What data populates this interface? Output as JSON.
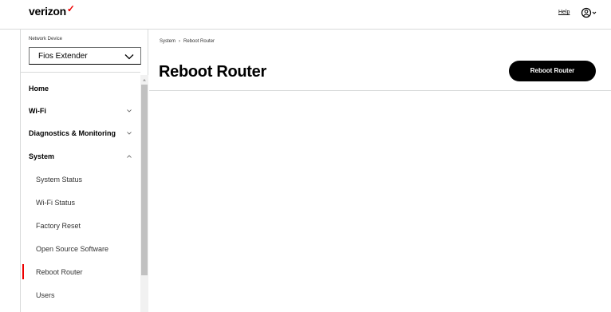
{
  "header": {
    "logo_text": "verizon",
    "logo_mark": "✓",
    "brand_color": "#ee0000",
    "help_label": "Help",
    "user_icon": "user-circle-icon"
  },
  "sidebar": {
    "device_label": "Network Device",
    "device_value": "Fios Extender",
    "items": [
      {
        "label": "Home",
        "kind": "top"
      },
      {
        "label": "Wi-Fi",
        "kind": "top",
        "chevron": "down"
      },
      {
        "label": "Diagnostics & Monitoring",
        "kind": "top",
        "chevron": "down"
      },
      {
        "label": "System",
        "kind": "top",
        "chevron": "up"
      },
      {
        "label": "System Status",
        "kind": "sub"
      },
      {
        "label": "Wi-Fi Status",
        "kind": "sub"
      },
      {
        "label": "Factory Reset",
        "kind": "sub"
      },
      {
        "label": "Open Source Software",
        "kind": "sub"
      },
      {
        "label": "Reboot Router",
        "kind": "sub",
        "active": true
      },
      {
        "label": "Users",
        "kind": "sub"
      }
    ]
  },
  "main": {
    "breadcrumb": [
      "System",
      "Reboot Router"
    ],
    "breadcrumb_sep": "›",
    "title": "Reboot Router",
    "action_label": "Reboot Router"
  }
}
